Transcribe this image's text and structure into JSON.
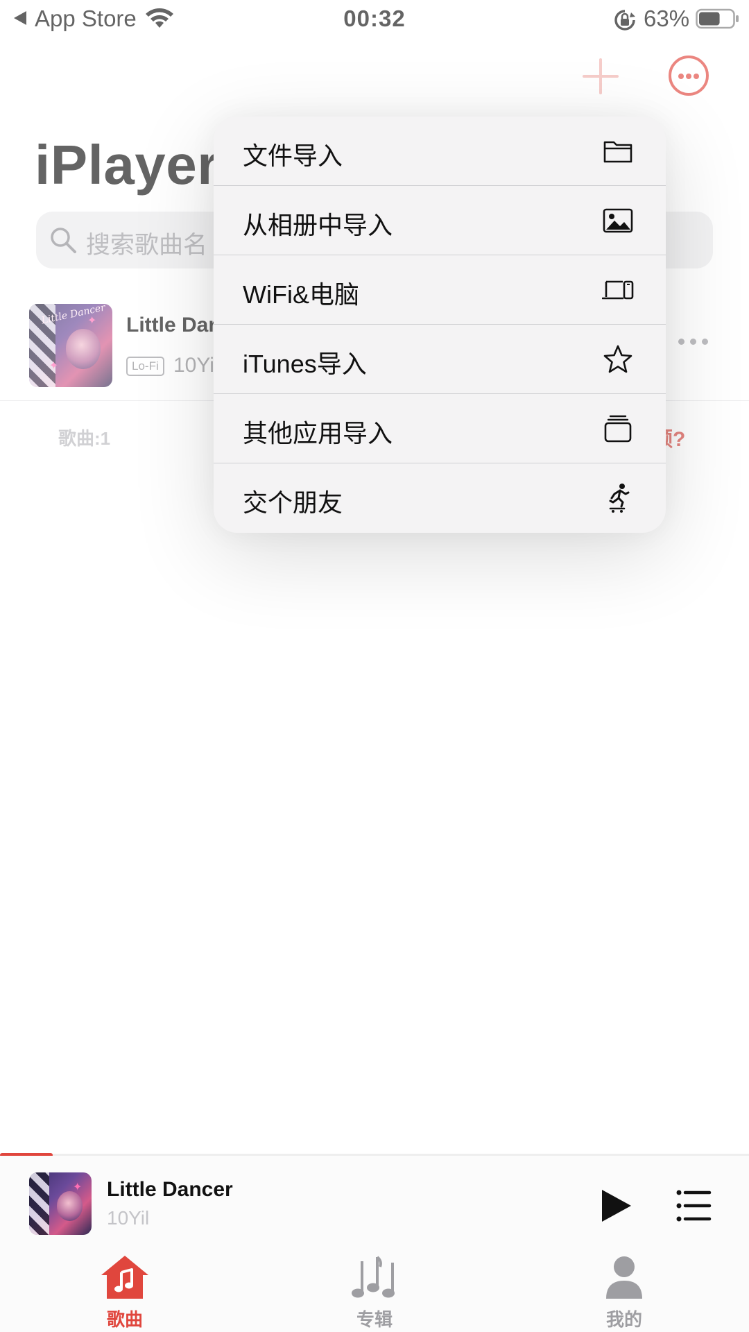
{
  "status_bar": {
    "back_app": "App Store",
    "time": "00:32",
    "battery_percent": "63%",
    "battery_level": 0.63
  },
  "header": {
    "title": "iPlayer",
    "search_placeholder": "搜索歌曲名"
  },
  "song_list": [
    {
      "title": "Little Dancer",
      "title_visible": "Little Dar",
      "quality": "Lo-Fi",
      "artist": "10Yil",
      "artist_visible": "10Yi",
      "cover_text": "Little Dancer"
    }
  ],
  "list_footer": {
    "count_label": "歌曲:1",
    "help_link_visible": "频?"
  },
  "popup_menu": {
    "items": [
      {
        "label": "文件导入",
        "icon": "folder-icon"
      },
      {
        "label": "从相册中导入",
        "icon": "photo-icon"
      },
      {
        "label": "WiFi&电脑",
        "icon": "laptop-phone-icon"
      },
      {
        "label": "iTunes导入",
        "icon": "star-icon"
      },
      {
        "label": "其他应用导入",
        "icon": "stack-icon"
      },
      {
        "label": "交个朋友",
        "icon": "skateboarder-icon"
      }
    ]
  },
  "mini_player": {
    "title": "Little Dancer",
    "artist": "10Yil",
    "progress": 0.07
  },
  "tab_bar": {
    "tabs": [
      {
        "label": "歌曲",
        "icon": "music-note-house-icon",
        "active": true
      },
      {
        "label": "专辑",
        "icon": "music-notes-icon",
        "active": false
      },
      {
        "label": "我的",
        "icon": "person-icon",
        "active": false
      }
    ]
  },
  "colors": {
    "accent": "#e0463d",
    "menu_background": "#f4f3f4",
    "search_background": "#ebebed",
    "secondary_text": "#8a8a8e",
    "inactive_tab": "#9e9ea2"
  }
}
